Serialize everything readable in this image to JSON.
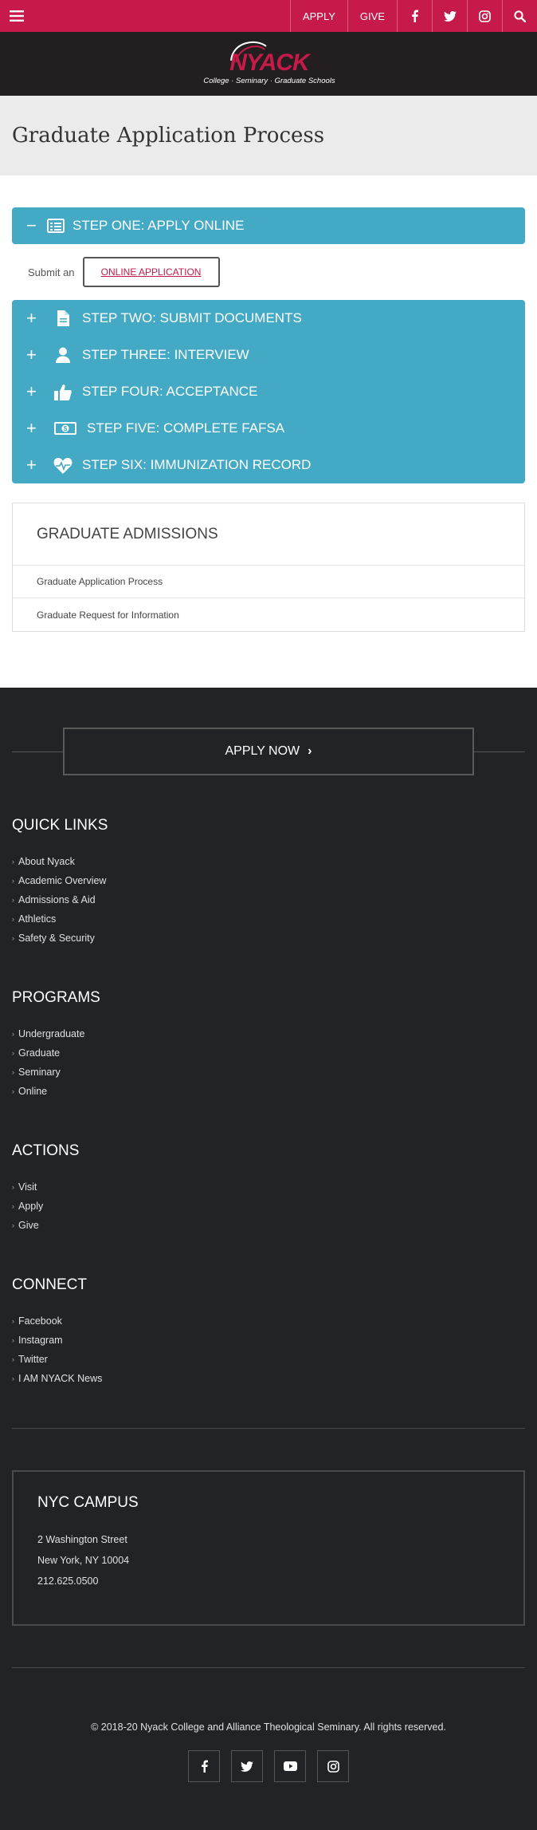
{
  "topbar": {
    "apply_label": "APPLY",
    "give_label": "GIVE"
  },
  "logo": {
    "name": "NYACK",
    "tagline": "College · Seminary · Graduate Schools"
  },
  "page": {
    "title": "Graduate Application Process"
  },
  "steps": {
    "open": {
      "label": "STEP ONE: APPLY ONLINE",
      "lead": "Submit an",
      "button": "ONLINE APPLICATION"
    },
    "closed": [
      {
        "label": "STEP TWO: SUBMIT DOCUMENTS",
        "icon": "document-icon"
      },
      {
        "label": "STEP THREE: INTERVIEW",
        "icon": "person-icon"
      },
      {
        "label": "STEP FOUR: ACCEPTANCE",
        "icon": "thumbs-up-icon"
      },
      {
        "label": "STEP FIVE: COMPLETE FAFSA",
        "icon": "money-icon"
      },
      {
        "label": "STEP SIX: IMMUNIZATION RECORD",
        "icon": "heartbeat-icon"
      }
    ]
  },
  "admissions": {
    "heading": "GRADUATE ADMISSIONS",
    "links": [
      "Graduate Application Process",
      "Graduate Request for Information"
    ]
  },
  "footer": {
    "apply_now": "APPLY NOW",
    "quick_links": {
      "heading": "QUICK LINKS",
      "items": [
        "About Nyack",
        "Academic Overview",
        "Admissions & Aid",
        "Athletics",
        "Safety & Security"
      ]
    },
    "programs": {
      "heading": "PROGRAMS",
      "items": [
        "Undergraduate",
        "Graduate",
        "Seminary",
        "Online"
      ]
    },
    "actions": {
      "heading": "ACTIONS",
      "items": [
        "Visit",
        "Apply",
        "Give"
      ]
    },
    "connect": {
      "heading": "CONNECT",
      "items": [
        "Facebook",
        "Instagram",
        "Twitter",
        "I AM NYACK News"
      ]
    },
    "campus": {
      "heading": "NYC CAMPUS",
      "street": "2 Washington Street",
      "city": "New York, NY 10004",
      "phone": "212.625.0500"
    },
    "copyright": "© 2018-20 Nyack College and Alliance Theological Seminary. All rights reserved."
  },
  "colors": {
    "brand_red": "#c51a4a",
    "accordion_blue": "#43a9c4",
    "footer_bg": "#222327"
  }
}
